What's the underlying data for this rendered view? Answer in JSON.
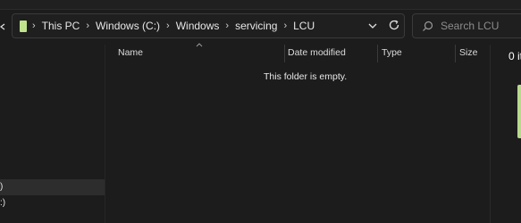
{
  "breadcrumb": [
    "This PC",
    "Windows (C:)",
    "Windows",
    "servicing",
    "LCU"
  ],
  "search": {
    "placeholder": "Search LCU"
  },
  "columns": [
    "Name",
    "Date modified",
    "Type",
    "Size"
  ],
  "empty_message": "This folder is empty.",
  "details": {
    "count_text": "0 it"
  },
  "nav": {
    "items": [
      ")",
      ":)"
    ]
  },
  "colors": {
    "accent": "#c0e48e",
    "background": "#1c1c1c"
  }
}
